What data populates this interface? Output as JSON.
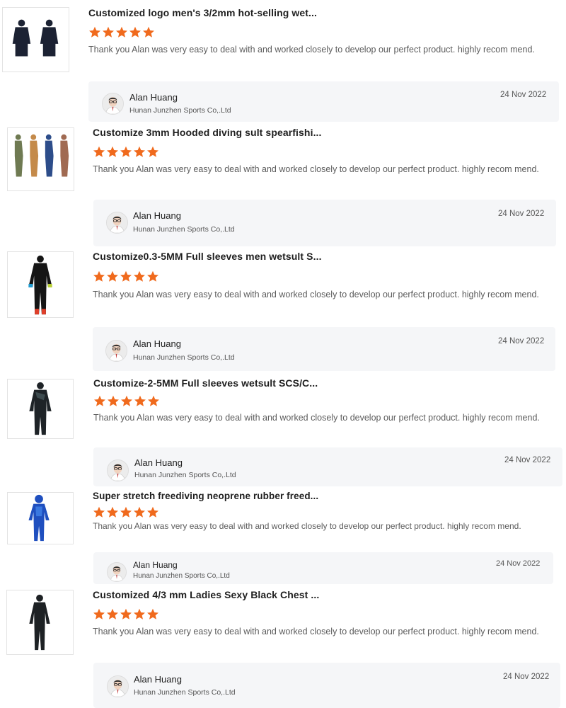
{
  "colors": {
    "star": "#f06a1d",
    "reply_bg": "#f5f6f8",
    "text": "#5c5c5c"
  },
  "reviews": [
    {
      "title": "Customized logo men's 3/2mm hot-selling wet...",
      "rating": 5,
      "text": "Thank you Alan was very easy to deal with and worked closely to develop our perfect product. highly recom mend.",
      "reply": {
        "name": "Alan Huang",
        "company": "Hunan Junzhen Sports Co,.Ltd",
        "date": "24 Nov 2022"
      }
    },
    {
      "title": "Customize 3mm Hooded diving sult spearfishi...",
      "rating": 5,
      "text": "Thank you Alan was very easy to deal with and worked closely to develop our perfect product. highly recom mend.",
      "reply": {
        "name": "Alan Huang",
        "company": "Hunan Junzhen Sports Co,.Ltd",
        "date": "24 Nov 2022"
      }
    },
    {
      "title": "Customize0.3-5MM Full sleeves men wetsult S...",
      "rating": 5,
      "text": "Thank you Alan was very easy to deal with and worked closely to develop our perfect product. highly recom mend.",
      "reply": {
        "name": "Alan Huang",
        "company": "Hunan Junzhen Sports Co,.Ltd",
        "date": "24 Nov 2022"
      }
    },
    {
      "title": "Customize-2-5MM Full sleeves wetsult SCS/C...",
      "rating": 5,
      "text": "Thank you Alan was very easy to deal with and worked closely to develop our perfect product. highly recom mend.",
      "reply": {
        "name": "Alan Huang",
        "company": "Hunan Junzhen Sports Co,.Ltd",
        "date": "24 Nov 2022"
      }
    },
    {
      "title": "Super stretch freediving neoprene rubber freed...",
      "rating": 5,
      "text": "Thank you Alan was very easy to deal with and worked closely to develop our perfect product. highly recom mend.",
      "reply": {
        "name": "Alan Huang",
        "company": "Hunan Junzhen Sports Co,.Ltd",
        "date": "24 Nov 2022"
      }
    },
    {
      "title": "Customized 4/3 mm Ladies Sexy Black Chest ...",
      "rating": 5,
      "text": "Thank you Alan was very easy to deal with and worked closely to develop our perfect product. highly recom mend.",
      "reply": {
        "name": "Alan Huang",
        "company": "Hunan Junzhen Sports Co,.Ltd",
        "date": "24 Nov 2022"
      }
    }
  ]
}
